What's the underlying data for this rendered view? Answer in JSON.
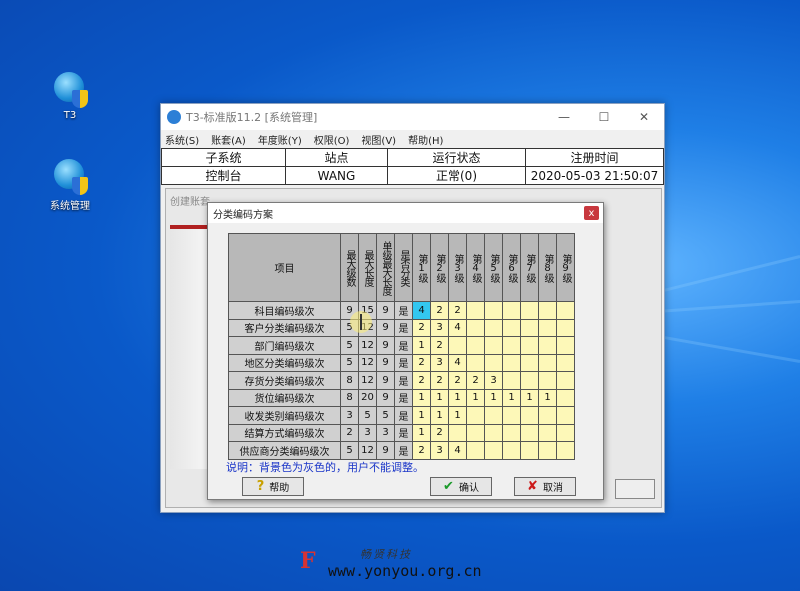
{
  "desktop": {
    "icons": [
      {
        "label": "T3"
      },
      {
        "label": "系统管理"
      }
    ]
  },
  "main_window": {
    "title": "T3-标准版11.2 [系统管理]",
    "menu": [
      "系统(S)",
      "账套(A)",
      "年度账(Y)",
      "权限(O)",
      "视图(V)",
      "帮助(H)"
    ],
    "status_table": {
      "headers": [
        "子系统",
        "站点",
        "运行状态",
        "注册时间"
      ],
      "row": [
        "控制台",
        "WANG",
        "正常(0)",
        "2020-05-03 21:50:07"
      ]
    },
    "inner_caption": "创建账套"
  },
  "dialog": {
    "title": "分类编码方案",
    "close": "x",
    "columns": {
      "item": "项目",
      "max_levels": "最大级数",
      "max_length": "最大长度",
      "single_max": "单级最大长度",
      "is_class": "是否分类",
      "levels": [
        "第1级",
        "第2级",
        "第3级",
        "第4级",
        "第5级",
        "第6级",
        "第7级",
        "第8级",
        "第9级"
      ]
    },
    "rows": [
      {
        "name": "科目编码级次",
        "max_levels": "9",
        "max_length": "15",
        "single_max": "9",
        "is_class": "是",
        "levels": [
          "4",
          "2",
          "2",
          "",
          "",
          "",
          "",
          "",
          ""
        ]
      },
      {
        "name": "客户分类编码级次",
        "max_levels": "5",
        "max_length": "12",
        "single_max": "9",
        "is_class": "是",
        "levels": [
          "2",
          "3",
          "4",
          "",
          "",
          "",
          "",
          "",
          ""
        ]
      },
      {
        "name": "部门编码级次",
        "max_levels": "5",
        "max_length": "12",
        "single_max": "9",
        "is_class": "是",
        "levels": [
          "1",
          "2",
          "",
          "",
          "",
          "",
          "",
          "",
          ""
        ]
      },
      {
        "name": "地区分类编码级次",
        "max_levels": "5",
        "max_length": "12",
        "single_max": "9",
        "is_class": "是",
        "levels": [
          "2",
          "3",
          "4",
          "",
          "",
          "",
          "",
          "",
          ""
        ]
      },
      {
        "name": "存货分类编码级次",
        "max_levels": "8",
        "max_length": "12",
        "single_max": "9",
        "is_class": "是",
        "levels": [
          "2",
          "2",
          "2",
          "2",
          "3",
          "",
          "",
          "",
          ""
        ]
      },
      {
        "name": "货位编码级次",
        "max_levels": "8",
        "max_length": "20",
        "single_max": "9",
        "is_class": "是",
        "levels": [
          "1",
          "1",
          "1",
          "1",
          "1",
          "1",
          "1",
          "1",
          ""
        ]
      },
      {
        "name": "收发类别编码级次",
        "max_levels": "3",
        "max_length": "5",
        "single_max": "5",
        "is_class": "是",
        "levels": [
          "1",
          "1",
          "1",
          "",
          "",
          "",
          "",
          "",
          ""
        ]
      },
      {
        "name": "结算方式编码级次",
        "max_levels": "2",
        "max_length": "3",
        "single_max": "3",
        "is_class": "是",
        "levels": [
          "1",
          "2",
          "",
          "",
          "",
          "",
          "",
          "",
          ""
        ]
      },
      {
        "name": "供应商分类编码级次",
        "max_levels": "5",
        "max_length": "12",
        "single_max": "9",
        "is_class": "是",
        "levels": [
          "2",
          "3",
          "4",
          "",
          "",
          "",
          "",
          "",
          ""
        ]
      }
    ],
    "note": "说明：背景色为灰色的，用户不能调整。",
    "buttons": {
      "help": "帮助",
      "ok": "确认",
      "cancel": "取消"
    }
  },
  "watermark": {
    "logo": "F",
    "company": "畅贤科技",
    "url": "www.yonyou.org.cn"
  },
  "colors": {
    "desktop": "#1f7fe6",
    "editable_cell": "#fdf8b8",
    "locked_cell": "#d0d0d0",
    "selected_cell": "#33c7f0",
    "note_text": "#1a35c8"
  }
}
